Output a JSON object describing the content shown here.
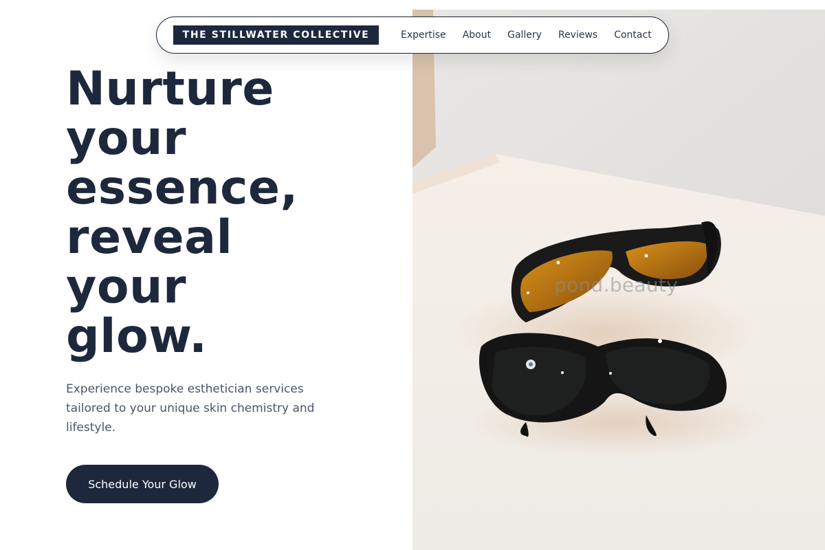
{
  "nav": {
    "brand": "THE STILLWATER COLLECTIVE",
    "links": [
      {
        "label": "Expertise"
      },
      {
        "label": "About"
      },
      {
        "label": "Gallery"
      },
      {
        "label": "Reviews"
      },
      {
        "label": "Contact"
      }
    ]
  },
  "hero": {
    "headline_lines": [
      "Nurture",
      "your",
      "essence,",
      "reveal",
      "your",
      "glow."
    ],
    "subtext": "Experience bespoke esthetician services tailored to your unique skin chemistry and lifestyle.",
    "cta_label": "Schedule Your Glow",
    "image_watermark": "pond.beauty"
  },
  "colors": {
    "primary": "#1e283d",
    "text_muted": "#4a5568",
    "background": "#ffffff"
  }
}
